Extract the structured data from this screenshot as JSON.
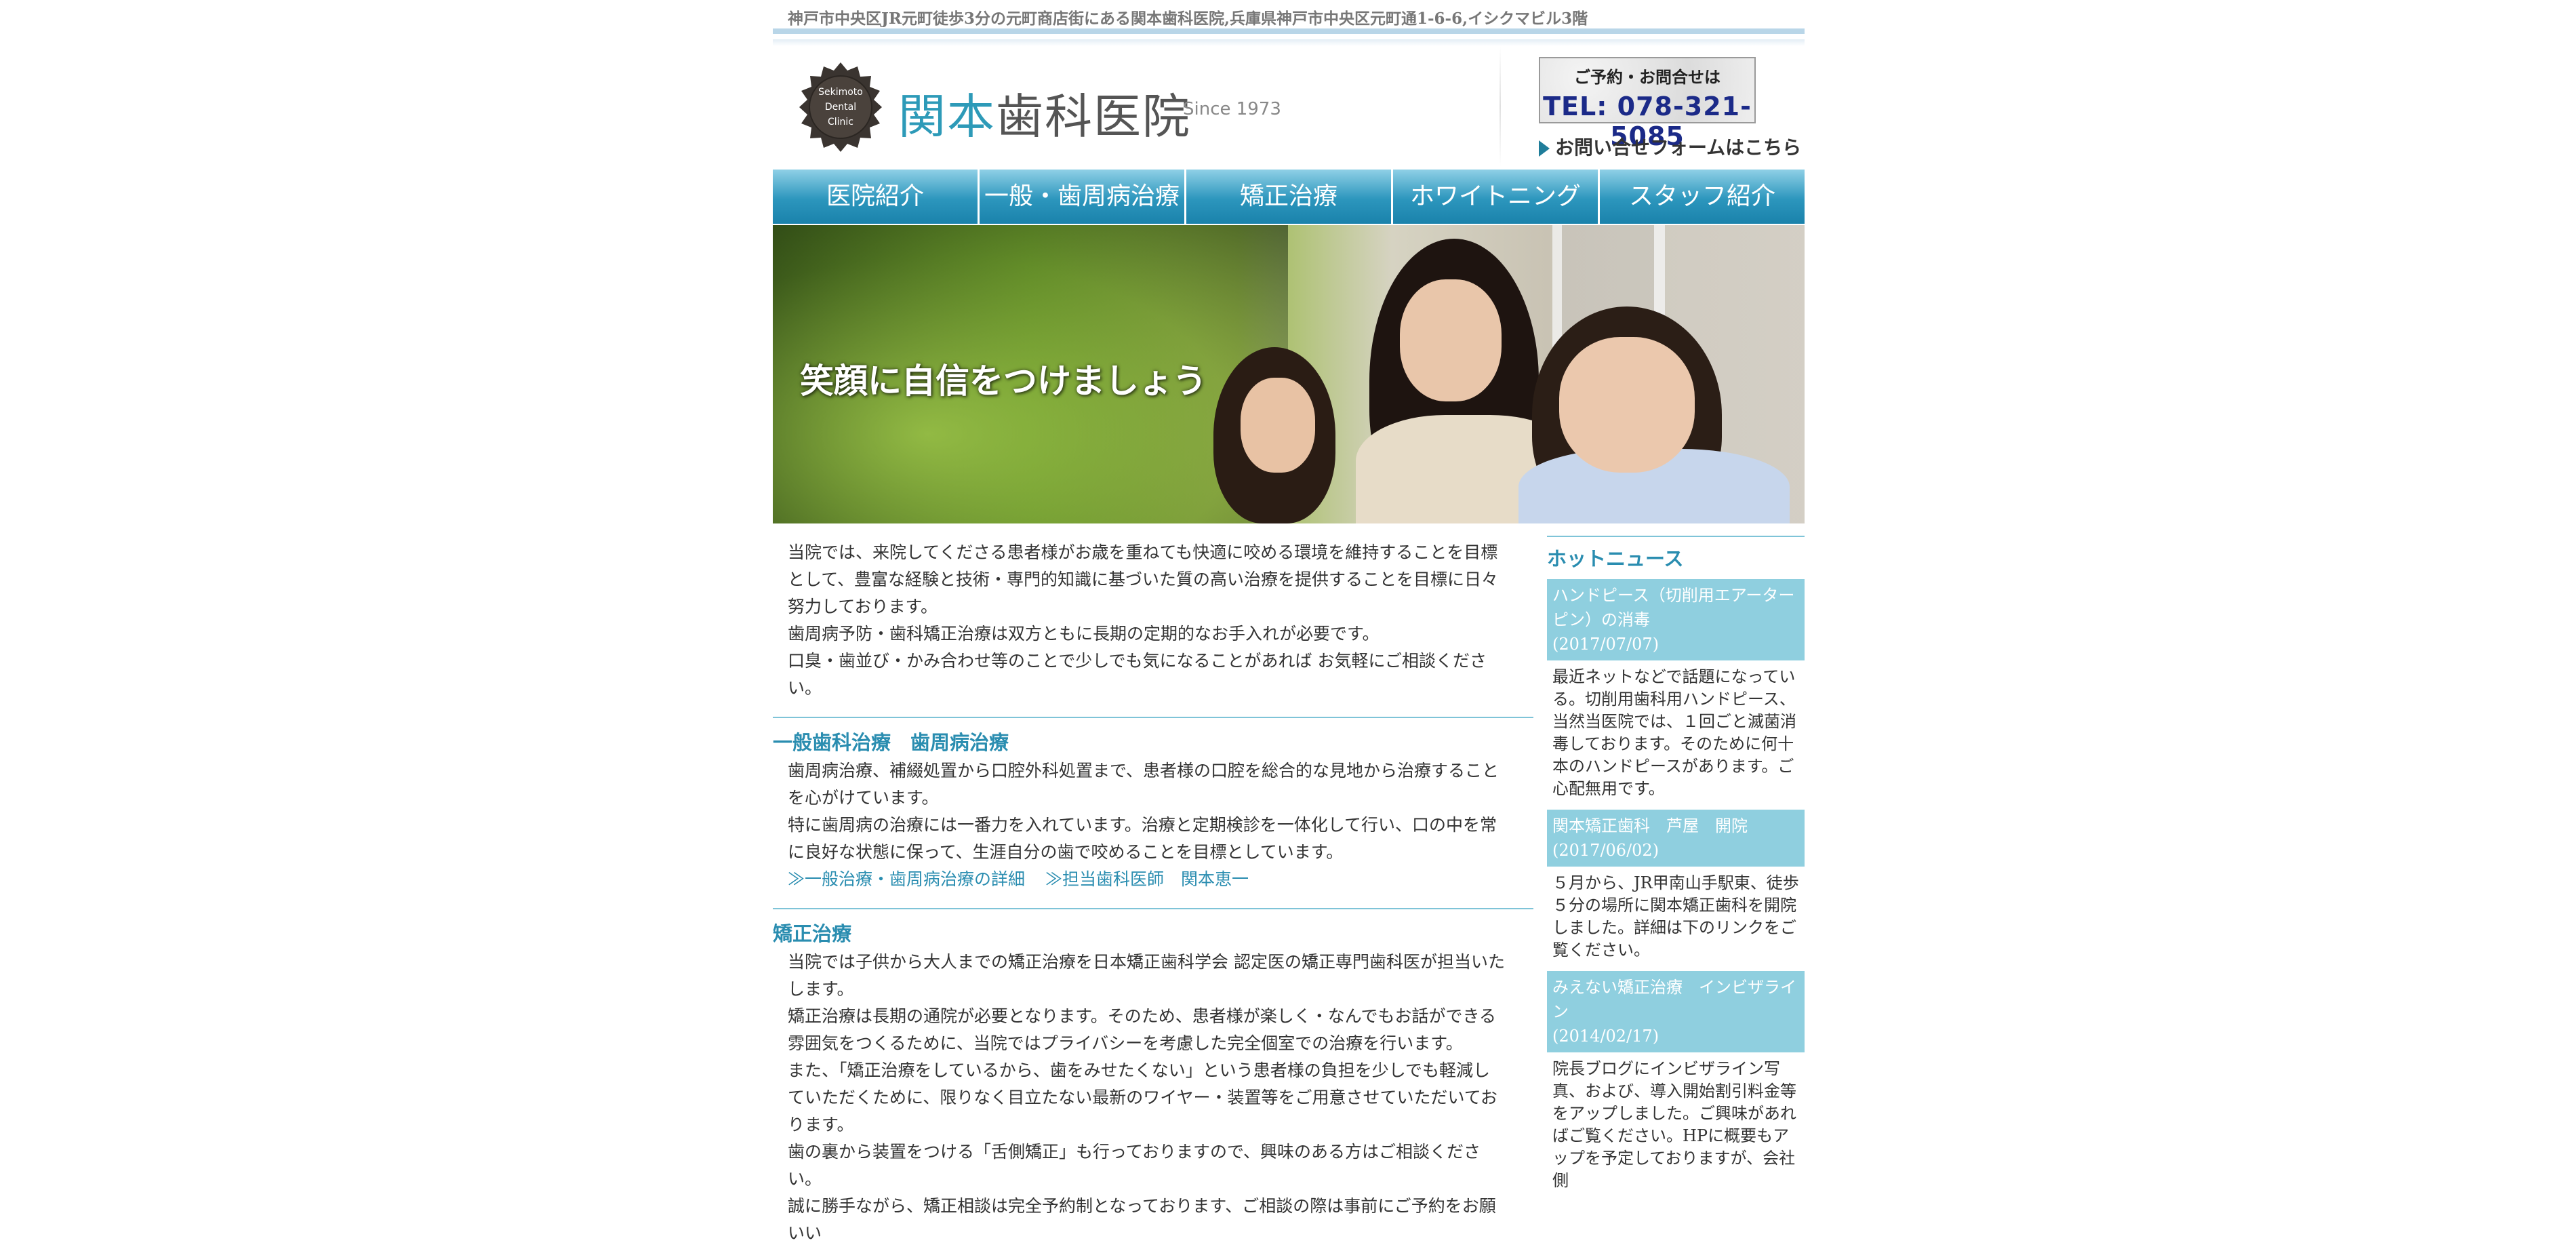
{
  "topbar": "神戸市中央区JR元町徒歩3分の元町商店街にある関本歯科医院,兵庫県神戸市中央区元町通1-6-6,イシクマビル3階",
  "header": {
    "seal_text": [
      "Sekimoto",
      "Dental",
      "Clinic"
    ],
    "logo_part1": "関本",
    "logo_part2": "歯科医院",
    "since": "Since 1973",
    "tel_caption": "ご予約・お問合せは",
    "tel_number": "TEL: 078-321-5085",
    "form_link": "お問い合せフォームはこちら"
  },
  "nav": [
    "医院紹介",
    "一般・歯周病治療",
    "矯正治療",
    "ホワイトニング",
    "スタッフ紹介"
  ],
  "hero": {
    "tagline": "笑顔に自信をつけましょう"
  },
  "main": {
    "intro": [
      "当院では、来院してくださる患者様がお歳を重ねても快適に咬める環境を維持することを目標として、豊富な経験と技術・専門的知識に基づいた質の高い治療を提供することを目標に日々努力しております。",
      "歯周病予防・歯科矯正治療は双方ともに長期の定期的なお手入れが必要です。",
      "口臭・歯並び・かみ合わせ等のことで少しでも気になることがあれば お気軽にご相談ください。"
    ],
    "general": {
      "title": "一般歯科治療　歯周病治療",
      "paras": [
        "歯周病治療、補綴処置から口腔外科処置まで、患者様の口腔を総合的な見地から治療することを心がけています。",
        "特に歯周病の治療には一番力を入れています。治療と定期検診を一体化して行い、口の中を常に良好な状態に保って、生涯自分の歯で咬めることを目標としています。"
      ],
      "link1": "≫一般治療・歯周病治療の詳細",
      "link2": "≫担当歯科医師　関本恵一"
    },
    "ortho": {
      "title": "矯正治療",
      "paras": [
        "当院では子供から大人までの矯正治療を日本矯正歯科学会 認定医の矯正専門歯科医が担当いたします。",
        "矯正治療は長期の通院が必要となります。そのため、患者様が楽しく・なんでもお話ができる雰囲気をつくるために、当院ではプライバシーを考慮した完全個室での治療を行います。",
        "また、「矯正治療をしているから、歯をみせたくない」という患者様の負担を少しでも軽減していただくために、限りなく目立たない最新のワイヤー・装置等をご用意させていただいております。",
        "歯の裏から装置をつける「舌側矯正」も行っておりますので、興味のある方はご相談ください。",
        "誠に勝手ながら、矯正相談は完全予約制となっております、ご相談の際は事前にご予約をお願いい"
      ]
    }
  },
  "sidebar": {
    "title": "ホットニュース",
    "news": [
      {
        "title": "ハンドピース（切削用エアーターピン）の消毒",
        "date": "(2017/07/07)",
        "body": "最近ネットなどで話題になっている。切削用歯科用ハンドピース、当然当医院では、１回ごと滅菌消毒しております。そのために何十本のハンドピースがあります。ご心配無用です。"
      },
      {
        "title": "関本矯正歯科　芦屋　開院",
        "date": "(2017/06/02)",
        "body": "５月から、JR甲南山手駅東、徒歩５分の場所に関本矯正歯科を開院しました。詳細は下のリンクをご覧ください。"
      },
      {
        "title": "みえない矯正治療　インビザライン",
        "date": "(2014/02/17)",
        "body": "院長ブログにインビザライン写真、および、導入開始割引料金等をアップしました。ご興味があればご覧ください。HPに概要もアップを予定しておりますが、会社側"
      }
    ]
  }
}
